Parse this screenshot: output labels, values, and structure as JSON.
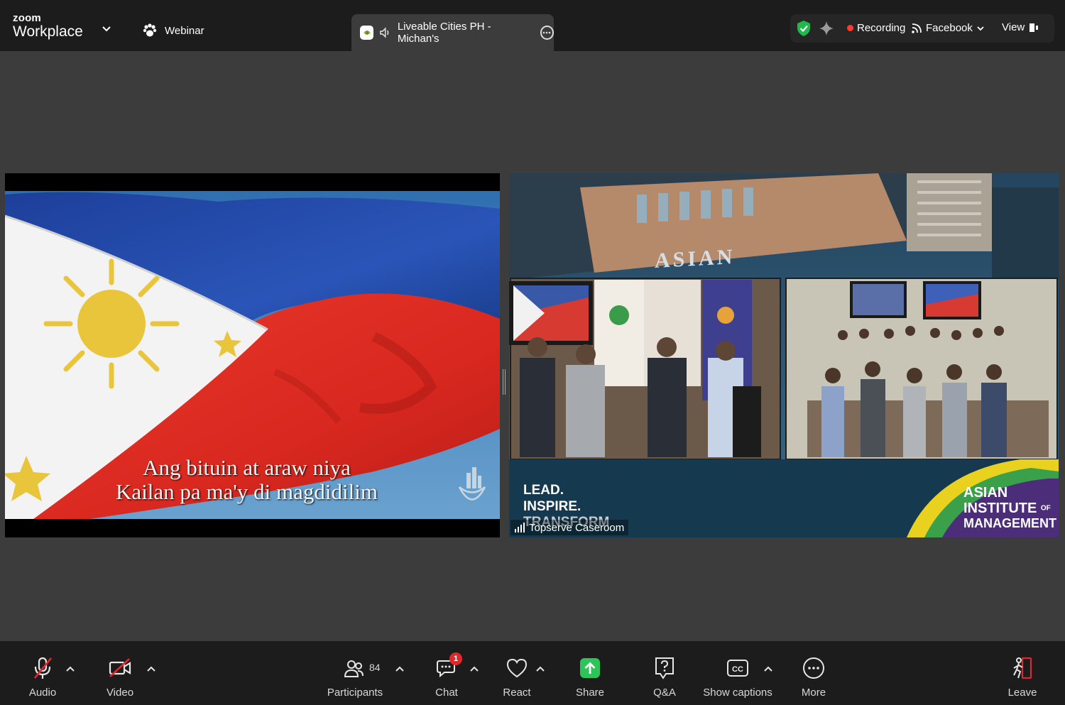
{
  "app": {
    "brand_top": "zoom",
    "brand_bottom": "Workplace"
  },
  "header": {
    "webinar_label": "Webinar",
    "tab_title": "Liveable Cities PH - Michan's",
    "recording_label": "Recording",
    "stream_label": "Facebook",
    "view_label": "View"
  },
  "left_video": {
    "lyric_line_1": "Ang bituin at araw niya",
    "lyric_line_2": "Kailan pa ma'y di magdidilim"
  },
  "right_video": {
    "building_sign": "ASIAN",
    "tagline_1": "LEAD.",
    "tagline_2": "INSPIRE.",
    "tagline_3": "TRANSFORM",
    "logo_line_1": "ASIAN",
    "logo_line_2": "INSTITUTE",
    "logo_of": "OF",
    "logo_line_3": "MANAGEMENT",
    "participant_name": "Topserve Caseroom"
  },
  "toolbar": {
    "audio": "Audio",
    "video": "Video",
    "participants": "Participants",
    "participants_count": "84",
    "chat": "Chat",
    "chat_badge": "1",
    "react": "React",
    "share": "Share",
    "qa": "Q&A",
    "captions": "Show captions",
    "more": "More",
    "leave": "Leave"
  },
  "colors": {
    "share_green": "#2bc55a",
    "recording_red": "#ff3b30",
    "badge_red": "#e0282c",
    "shield_green": "#1fbb4a",
    "flag_blue": "#1f47a8",
    "flag_red": "#e0322a",
    "flag_sun": "#e8c53a",
    "aim_purple": "#4b2d7a"
  }
}
